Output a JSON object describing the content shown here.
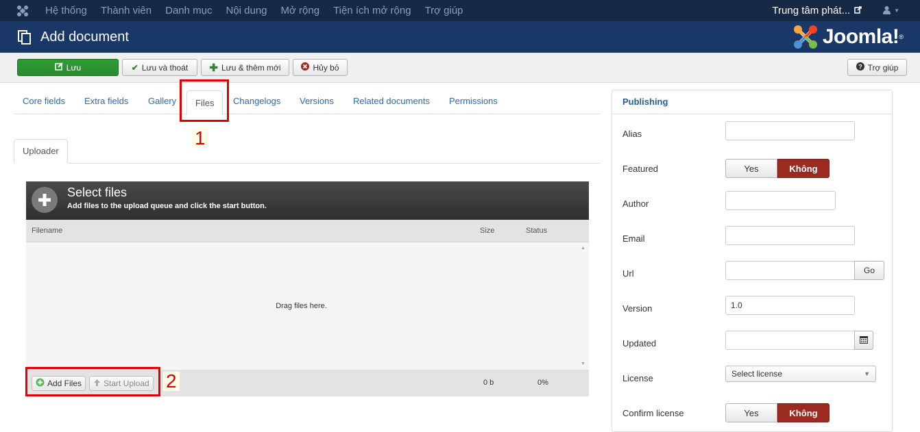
{
  "navbar": {
    "menu": [
      "Hệ thống",
      "Thành viên",
      "Danh mục",
      "Nội dung",
      "Mở rộng",
      "Tiện ích mở rộng",
      "Trợ giúp"
    ],
    "site_label": "Trung tâm phát..."
  },
  "header": {
    "title": "Add document",
    "logo_text": "Joomla!"
  },
  "toolbar": {
    "save": "Lưu",
    "save_close": "Lưu và thoát",
    "save_new": "Lưu & thêm mới",
    "cancel": "Hủy bỏ",
    "help": "Trợ giúp"
  },
  "tabs": [
    "Core fields",
    "Extra fields",
    "Gallery",
    "Files",
    "Changelogs",
    "Versions",
    "Related documents",
    "Permissions"
  ],
  "active_tab": "Files",
  "subtabs": [
    "Uploader"
  ],
  "annotations": [
    "1",
    "2"
  ],
  "uploader": {
    "title": "Select files",
    "subtitle": "Add files to the upload queue and click the start button.",
    "columns": {
      "filename": "Filename",
      "size": "Size",
      "status": "Status"
    },
    "drop_text": "Drag files here.",
    "add_files": "Add Files",
    "start_upload": "Start Upload",
    "total_size": "0 b",
    "total_percent": "0%"
  },
  "publishing": {
    "title": "Publishing",
    "fields": {
      "alias": {
        "label": "Alias",
        "value": ""
      },
      "featured": {
        "label": "Featured",
        "yes": "Yes",
        "no": "Không",
        "selected": "Không"
      },
      "author": {
        "label": "Author",
        "value": ""
      },
      "email": {
        "label": "Email",
        "value": ""
      },
      "url": {
        "label": "Url",
        "value": "",
        "button": "Go"
      },
      "version": {
        "label": "Version",
        "value": "1.0"
      },
      "updated": {
        "label": "Updated",
        "value": ""
      },
      "license": {
        "label": "License",
        "selected": "Select license"
      },
      "confirm_license": {
        "label": "Confirm license",
        "yes": "Yes",
        "no": "Không",
        "selected": "Không"
      }
    }
  },
  "colors": {
    "navbar": "#172a45",
    "header": "#1a3867",
    "save_green": "#2e9d35",
    "active_no": "#9b2a21",
    "link": "#2a69b8",
    "annotation": "#e00000"
  }
}
